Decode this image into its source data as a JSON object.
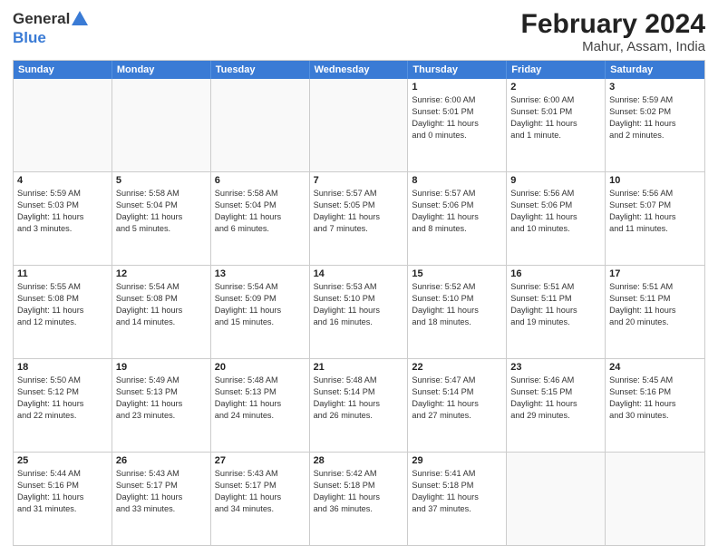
{
  "header": {
    "logo_general": "General",
    "logo_blue": "Blue",
    "title": "February 2024",
    "subtitle": "Mahur, Assam, India"
  },
  "days_of_week": [
    "Sunday",
    "Monday",
    "Tuesday",
    "Wednesday",
    "Thursday",
    "Friday",
    "Saturday"
  ],
  "weeks": [
    [
      {
        "day": "",
        "info": ""
      },
      {
        "day": "",
        "info": ""
      },
      {
        "day": "",
        "info": ""
      },
      {
        "day": "",
        "info": ""
      },
      {
        "day": "1",
        "info": "Sunrise: 6:00 AM\nSunset: 5:01 PM\nDaylight: 11 hours\nand 0 minutes."
      },
      {
        "day": "2",
        "info": "Sunrise: 6:00 AM\nSunset: 5:01 PM\nDaylight: 11 hours\nand 1 minute."
      },
      {
        "day": "3",
        "info": "Sunrise: 5:59 AM\nSunset: 5:02 PM\nDaylight: 11 hours\nand 2 minutes."
      }
    ],
    [
      {
        "day": "4",
        "info": "Sunrise: 5:59 AM\nSunset: 5:03 PM\nDaylight: 11 hours\nand 3 minutes."
      },
      {
        "day": "5",
        "info": "Sunrise: 5:58 AM\nSunset: 5:04 PM\nDaylight: 11 hours\nand 5 minutes."
      },
      {
        "day": "6",
        "info": "Sunrise: 5:58 AM\nSunset: 5:04 PM\nDaylight: 11 hours\nand 6 minutes."
      },
      {
        "day": "7",
        "info": "Sunrise: 5:57 AM\nSunset: 5:05 PM\nDaylight: 11 hours\nand 7 minutes."
      },
      {
        "day": "8",
        "info": "Sunrise: 5:57 AM\nSunset: 5:06 PM\nDaylight: 11 hours\nand 8 minutes."
      },
      {
        "day": "9",
        "info": "Sunrise: 5:56 AM\nSunset: 5:06 PM\nDaylight: 11 hours\nand 10 minutes."
      },
      {
        "day": "10",
        "info": "Sunrise: 5:56 AM\nSunset: 5:07 PM\nDaylight: 11 hours\nand 11 minutes."
      }
    ],
    [
      {
        "day": "11",
        "info": "Sunrise: 5:55 AM\nSunset: 5:08 PM\nDaylight: 11 hours\nand 12 minutes."
      },
      {
        "day": "12",
        "info": "Sunrise: 5:54 AM\nSunset: 5:08 PM\nDaylight: 11 hours\nand 14 minutes."
      },
      {
        "day": "13",
        "info": "Sunrise: 5:54 AM\nSunset: 5:09 PM\nDaylight: 11 hours\nand 15 minutes."
      },
      {
        "day": "14",
        "info": "Sunrise: 5:53 AM\nSunset: 5:10 PM\nDaylight: 11 hours\nand 16 minutes."
      },
      {
        "day": "15",
        "info": "Sunrise: 5:52 AM\nSunset: 5:10 PM\nDaylight: 11 hours\nand 18 minutes."
      },
      {
        "day": "16",
        "info": "Sunrise: 5:51 AM\nSunset: 5:11 PM\nDaylight: 11 hours\nand 19 minutes."
      },
      {
        "day": "17",
        "info": "Sunrise: 5:51 AM\nSunset: 5:11 PM\nDaylight: 11 hours\nand 20 minutes."
      }
    ],
    [
      {
        "day": "18",
        "info": "Sunrise: 5:50 AM\nSunset: 5:12 PM\nDaylight: 11 hours\nand 22 minutes."
      },
      {
        "day": "19",
        "info": "Sunrise: 5:49 AM\nSunset: 5:13 PM\nDaylight: 11 hours\nand 23 minutes."
      },
      {
        "day": "20",
        "info": "Sunrise: 5:48 AM\nSunset: 5:13 PM\nDaylight: 11 hours\nand 24 minutes."
      },
      {
        "day": "21",
        "info": "Sunrise: 5:48 AM\nSunset: 5:14 PM\nDaylight: 11 hours\nand 26 minutes."
      },
      {
        "day": "22",
        "info": "Sunrise: 5:47 AM\nSunset: 5:14 PM\nDaylight: 11 hours\nand 27 minutes."
      },
      {
        "day": "23",
        "info": "Sunrise: 5:46 AM\nSunset: 5:15 PM\nDaylight: 11 hours\nand 29 minutes."
      },
      {
        "day": "24",
        "info": "Sunrise: 5:45 AM\nSunset: 5:16 PM\nDaylight: 11 hours\nand 30 minutes."
      }
    ],
    [
      {
        "day": "25",
        "info": "Sunrise: 5:44 AM\nSunset: 5:16 PM\nDaylight: 11 hours\nand 31 minutes."
      },
      {
        "day": "26",
        "info": "Sunrise: 5:43 AM\nSunset: 5:17 PM\nDaylight: 11 hours\nand 33 minutes."
      },
      {
        "day": "27",
        "info": "Sunrise: 5:43 AM\nSunset: 5:17 PM\nDaylight: 11 hours\nand 34 minutes."
      },
      {
        "day": "28",
        "info": "Sunrise: 5:42 AM\nSunset: 5:18 PM\nDaylight: 11 hours\nand 36 minutes."
      },
      {
        "day": "29",
        "info": "Sunrise: 5:41 AM\nSunset: 5:18 PM\nDaylight: 11 hours\nand 37 minutes."
      },
      {
        "day": "",
        "info": ""
      },
      {
        "day": "",
        "info": ""
      }
    ]
  ]
}
